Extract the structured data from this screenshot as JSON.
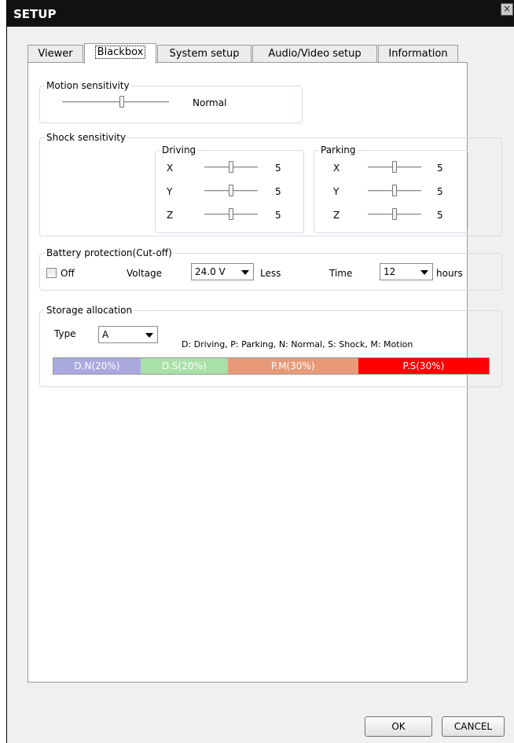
{
  "window": {
    "title": "SETUP",
    "close_symbol": "×"
  },
  "tabs": [
    "Viewer",
    "Blackbox",
    "System setup",
    "Audio/Video setup",
    "Information"
  ],
  "active_tab": "Blackbox",
  "motion": {
    "title": "Motion sensitivity",
    "value_label": "Normal",
    "level": 0.56
  },
  "shock": {
    "title": "Shock sensitivity",
    "driving": {
      "title": "Driving",
      "axes": [
        {
          "axis": "X",
          "value": "5"
        },
        {
          "axis": "Y",
          "value": "5"
        },
        {
          "axis": "Z",
          "value": "5"
        }
      ]
    },
    "parking": {
      "title": "Parking",
      "axes": [
        {
          "axis": "X",
          "value": "5"
        },
        {
          "axis": "Y",
          "value": "5"
        },
        {
          "axis": "Z",
          "value": "5"
        }
      ]
    },
    "level": 0.5
  },
  "battery": {
    "title": "Battery protection(Cut-off)",
    "off_label": "Off",
    "off_checked": false,
    "voltage_label": "Voltage",
    "voltage_value": "24.0 V",
    "less_label": "Less",
    "time_label": "Time",
    "time_value": "12",
    "hours_label": "hours"
  },
  "storage": {
    "title": "Storage allocation",
    "type_label": "Type",
    "type_value": "A",
    "legend": "D: Driving,  P: Parking,  N: Normal,  S: Shock,  M: Motion",
    "segments": [
      {
        "label": "D.N(20%)",
        "percent": 20,
        "color": "#a9a9e0"
      },
      {
        "label": "D.S(20%)",
        "percent": 20,
        "color": "#a8e0a8"
      },
      {
        "label": "P.M(30%)",
        "percent": 30,
        "color": "#e89a78"
      },
      {
        "label": "P.S(30%)",
        "percent": 30,
        "color": "#ff0000"
      }
    ]
  },
  "buttons": {
    "ok": "OK",
    "cancel": "CANCEL"
  }
}
